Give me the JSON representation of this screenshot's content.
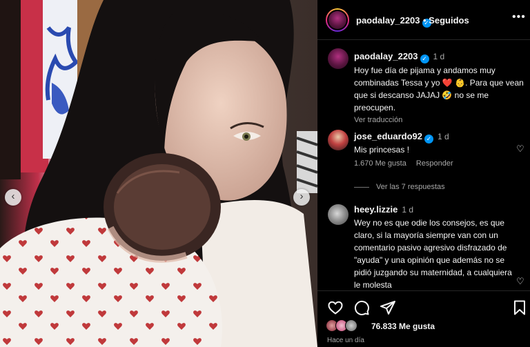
{
  "post": {
    "username": "paodalay_2203",
    "follow_status": "Seguidos",
    "more_icon": "more-horizontal-icon",
    "caption": {
      "username": "paodalay_2203",
      "time": "1 d",
      "text": "Hoy fue día de pijama y andamos muy combinadas Tessa y yo ❤️ 👶. Para que vean que si descanso JAJAJ 🤣  no se me preocupen.",
      "see_translation": "Ver traducción"
    },
    "comments": [
      {
        "username": "jose_eduardo92",
        "verified": true,
        "time": "1 d",
        "text": "Mis princesas !",
        "likes": "1.670 Me gusta",
        "reply_label": "Responder",
        "view_replies": "Ver las 7 respuestas"
      },
      {
        "username": "heey.lizzie",
        "verified": false,
        "time": "1 d",
        "text": "Wey no es que odie los consejos, es que claro, si la mayoría siempre van con un comentario pasivo agresivo disfrazado de \"ayuda\" y una opinión que además no se pidió juzgando su maternidad, a cualquiera le molesta"
      }
    ],
    "likes_count": "76.833 Me gusta",
    "posted_ago": "Hace un día"
  },
  "colors": {
    "background": "#000000",
    "text": "#f5f5f5",
    "muted": "#a8a8a8",
    "verified": "#0095f6",
    "heart_pattern": "#c0393b"
  }
}
